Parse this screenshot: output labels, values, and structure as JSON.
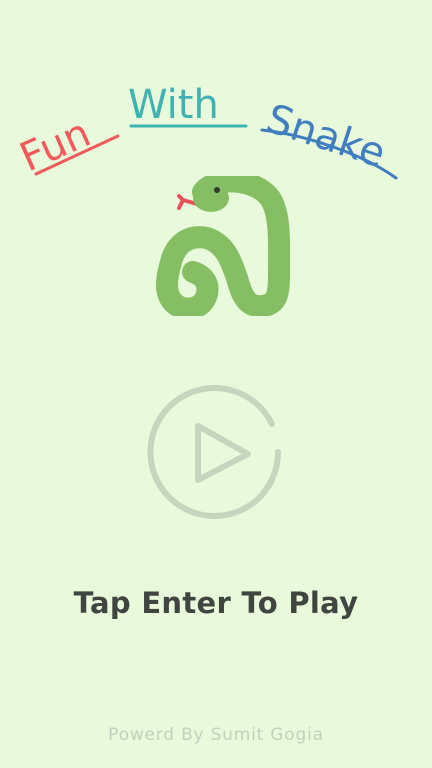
{
  "title": {
    "word1": "Fun",
    "word2": "With",
    "word3": "Snake",
    "color1": "#f05a5a",
    "color2": "#3fb3b3",
    "color3": "#3f7fc1"
  },
  "logo": {
    "icon": "snake-icon",
    "body_color": "#86bf63",
    "tongue_color": "#e8505b"
  },
  "play": {
    "icon": "play-icon",
    "color": "#c7d5bf"
  },
  "prompt": "Tap Enter To Play",
  "footer": "Powerd By Sumit Gogia"
}
